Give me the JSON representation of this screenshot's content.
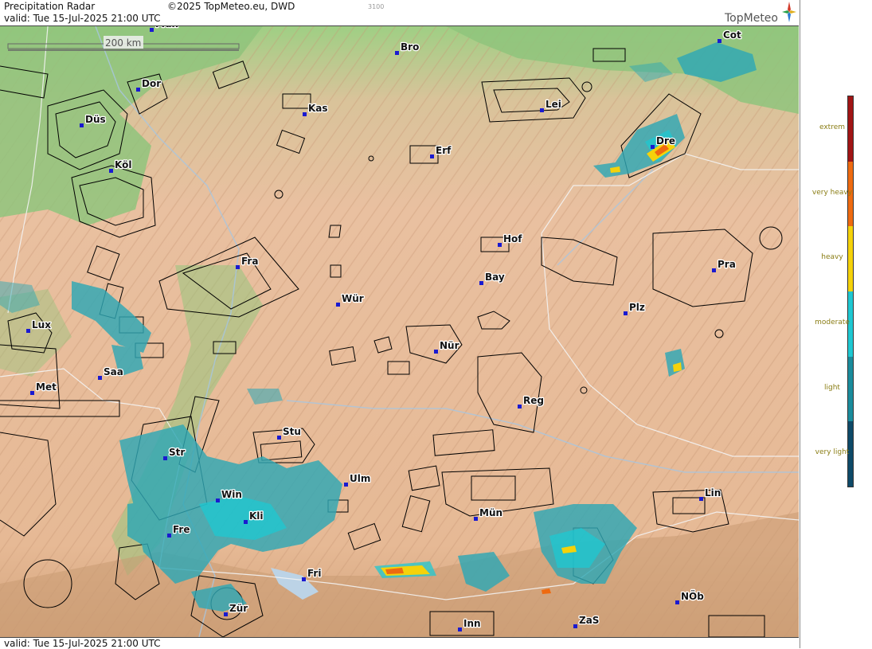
{
  "header": {
    "title": "Precipitation Radar",
    "copyright": "©2025 TopMeteo.eu, DWD",
    "code": "3100",
    "valid": "valid:  Tue  15-Jul-2025 21:00 UTC",
    "brand": "TopMeteo"
  },
  "footer": {
    "valid": "valid:  Tue  15-Jul-2025 21:00 UTC"
  },
  "scale": {
    "label": "200 km"
  },
  "legend": {
    "items": [
      {
        "label": "extrem",
        "color": "#a01414"
      },
      {
        "label": "very heavy",
        "color": "#ee6a10"
      },
      {
        "label": "heavy",
        "color": "#f5d20a"
      },
      {
        "label": "moderate",
        "color": "#1ec8d2"
      },
      {
        "label": "light",
        "color": "#1a8c9c"
      },
      {
        "label": "very light",
        "color": "#0e4a68"
      }
    ]
  },
  "cities": [
    {
      "name": "Mün"
    },
    {
      "name": "Bro"
    },
    {
      "name": "Cot"
    },
    {
      "name": "Dor"
    },
    {
      "name": "Kas"
    },
    {
      "name": "Lei"
    },
    {
      "name": "Düs"
    },
    {
      "name": "Erf"
    },
    {
      "name": "Dre"
    },
    {
      "name": "Köl"
    },
    {
      "name": "Hof"
    },
    {
      "name": "Fra"
    },
    {
      "name": "Pra"
    },
    {
      "name": "Bay"
    },
    {
      "name": "Wür"
    },
    {
      "name": "Plz"
    },
    {
      "name": "Lux"
    },
    {
      "name": "Nür"
    },
    {
      "name": "Saa"
    },
    {
      "name": "Met"
    },
    {
      "name": "Reg"
    },
    {
      "name": "Stu"
    },
    {
      "name": "Str"
    },
    {
      "name": "Ulm"
    },
    {
      "name": "Win"
    },
    {
      "name": "Lin"
    },
    {
      "name": "Kli"
    },
    {
      "name": "Mün"
    },
    {
      "name": "Fre"
    },
    {
      "name": "Fri"
    },
    {
      "name": "NÖb"
    },
    {
      "name": "Zür"
    },
    {
      "name": "Inn"
    },
    {
      "name": "ZaS"
    }
  ],
  "colors": {
    "lowland": "#8fc47c",
    "upland": "#e9bf9c",
    "mountain": "#d7aa82",
    "precip_light": "#3fb0b8",
    "precip_moderate": "#1ec8d2",
    "precip_heavy": "#f5d20a",
    "precip_very_heavy": "#ee6a10"
  }
}
